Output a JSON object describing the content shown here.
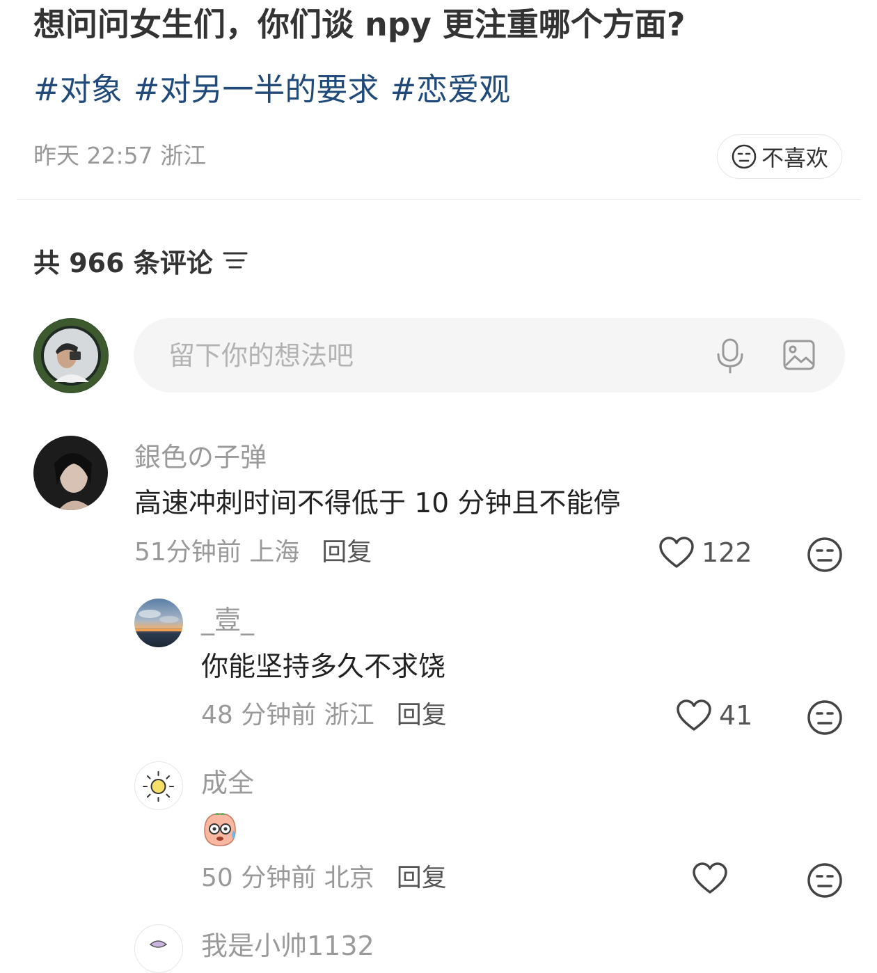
{
  "post": {
    "title": "想问问女生们，你们谈 npy 更注重哪个方面?",
    "tags": [
      "#对象",
      "#对另一半的要求",
      "#恋爱观"
    ],
    "meta": "昨天 22:57 浙江",
    "dislike_label": "不喜欢"
  },
  "comments_header": {
    "count_text": "共 966 条评论"
  },
  "input": {
    "placeholder": "留下你的想法吧"
  },
  "comments": [
    {
      "name": "銀色の子弹",
      "text": "高速冲刺时间不得低于 10 分钟且不能停",
      "time": "51分钟前 上海",
      "reply_label": "回复",
      "likes": "122"
    },
    {
      "name": "_壹_",
      "text": "你能坚持多久不求饶",
      "time": "48 分钟前 浙江",
      "reply_label": "回复",
      "likes": "41"
    },
    {
      "name": "成全",
      "text": "",
      "time": "50 分钟前 北京",
      "reply_label": "回复",
      "likes": ""
    },
    {
      "name": "我是小帅1132"
    }
  ],
  "colors": {
    "tag": "#1f4a7a",
    "secondary_text": "#999999",
    "input_bg": "#f5f5f5"
  },
  "icons": [
    "neutral-face-icon",
    "filter-icon",
    "microphone-icon",
    "image-icon",
    "heart-icon",
    "sun-icon",
    "sweat-emoji-icon"
  ]
}
